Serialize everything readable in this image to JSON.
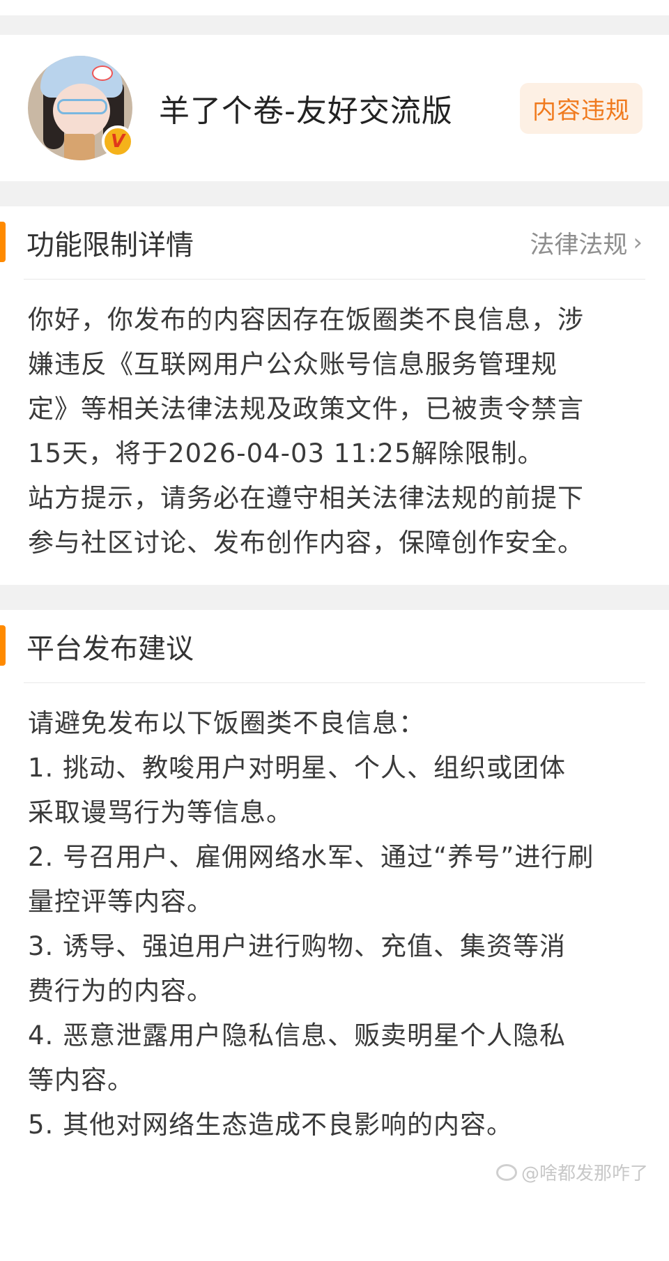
{
  "profile": {
    "username": "羊了个卷-友好交流版",
    "badge": "内容违规",
    "verified_mark": "V"
  },
  "restriction": {
    "title": "功能限制详情",
    "link": "法律法规",
    "chevron": "›",
    "lines": [
      "你好，你发布的内容因存在饭圈类不良信息，涉",
      "嫌违反《互联网用户公众账号信息服务管理规",
      "定》等相关法律法规及政策文件，已被责令禁言",
      "15天，将于2026-04-03 11:25解除限制。",
      "站方提示，请务必在遵守相关法律法规的前提下",
      "参与社区讨论、发布创作内容，保障创作安全。"
    ]
  },
  "advice": {
    "title": "平台发布建议",
    "lines": [
      "请避免发布以下饭圈类不良信息：",
      "1. 挑动、教唆用户对明星、个人、组织或团体",
      "采取谩骂行为等信息。",
      "2. 号召用户、雇佣网络水军、通过“养号”进行刷",
      "量控评等内容。",
      "3. 诱导、强迫用户进行购物、充值、集资等消",
      "费行为的内容。",
      "4. 恶意泄露用户隐私信息、贩卖明星个人隐私",
      "等内容。",
      "5. 其他对网络生态造成不良影响的内容。"
    ]
  },
  "watermark": {
    "text": "@啥都发那咋了"
  },
  "colors": {
    "accent": "#ff8a00",
    "badge_text": "#f07a1e",
    "badge_bg": "#fdf0e4"
  }
}
